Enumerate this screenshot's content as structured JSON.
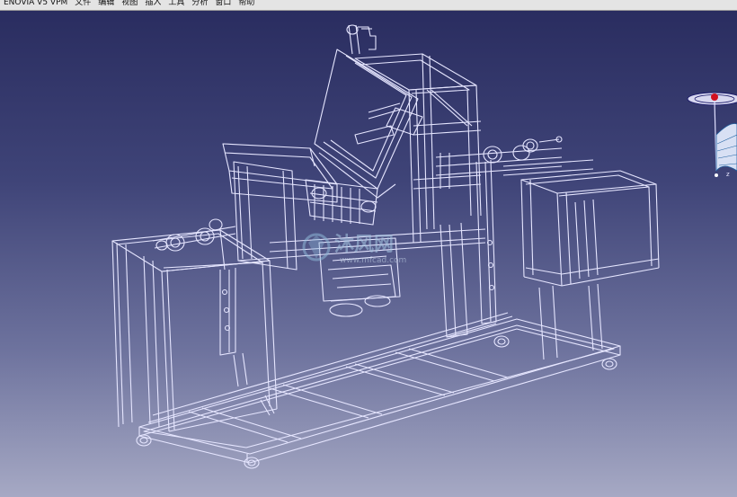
{
  "menu": {
    "items": [
      {
        "label": "ENOVIA V5 VPM"
      },
      {
        "label": "文件"
      },
      {
        "label": "编辑"
      },
      {
        "label": "视图"
      },
      {
        "label": "插入"
      },
      {
        "label": "工具"
      },
      {
        "label": "分析"
      },
      {
        "label": "窗口"
      },
      {
        "label": "帮助"
      }
    ]
  },
  "watermark": {
    "brand": "沐风网",
    "url": "www.mfcad.com"
  },
  "compass": {
    "axis_label": "z"
  },
  "colors": {
    "wireframe": "#e6e6ff",
    "viewport_top": "#2a2d60",
    "viewport_bottom": "#a6a9c4"
  }
}
